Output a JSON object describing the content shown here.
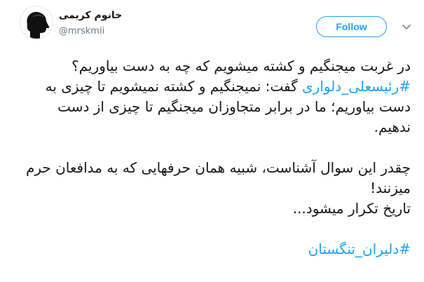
{
  "header": {
    "display_name": "خانوم کریمی",
    "handle": "@mrskmii",
    "follow_label": "Follow"
  },
  "tweet": {
    "line1": "در غربت میجنگیم و کشته میشویم که چه به دست بیاوریم؟",
    "hashtag1": "#رئیسعلی_دلواری",
    "line2_rest": " گفت: نمیجنگیم و کشته نمیشویم تا چیزی به دست بیاوریم؛ ما در برابر متجاوزان میجنگیم تا چیزی از دست ندهیم.",
    "paragraph2": "چقدر این سوال آشناست، شبیه همان حرفهایی که به مدافعان حرم میزنند!",
    "paragraph3": "تاریخ تکرار میشود...",
    "hashtag2": "#دلیران_تنگستان"
  },
  "colors": {
    "link": "#1da1f2",
    "text": "#14171a",
    "secondary": "#657786"
  },
  "icons": {
    "avatar": "silhouette-avatar",
    "menu": "chevron-down-icon"
  }
}
